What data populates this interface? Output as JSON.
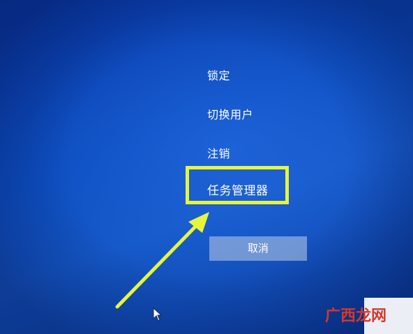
{
  "menu": {
    "lock_label": "锁定",
    "switch_user_label": "切换用户",
    "sign_out_label": "注销",
    "task_manager_label": "任务管理器"
  },
  "cancel_button": {
    "label": "取消"
  },
  "annotation": {
    "highlight_color": "#e6f53a",
    "arrow_color": "#e6f53a"
  },
  "watermark": {
    "text": "广西龙网"
  },
  "colors": {
    "background": "#0d4fc2",
    "text": "#ffffff"
  }
}
